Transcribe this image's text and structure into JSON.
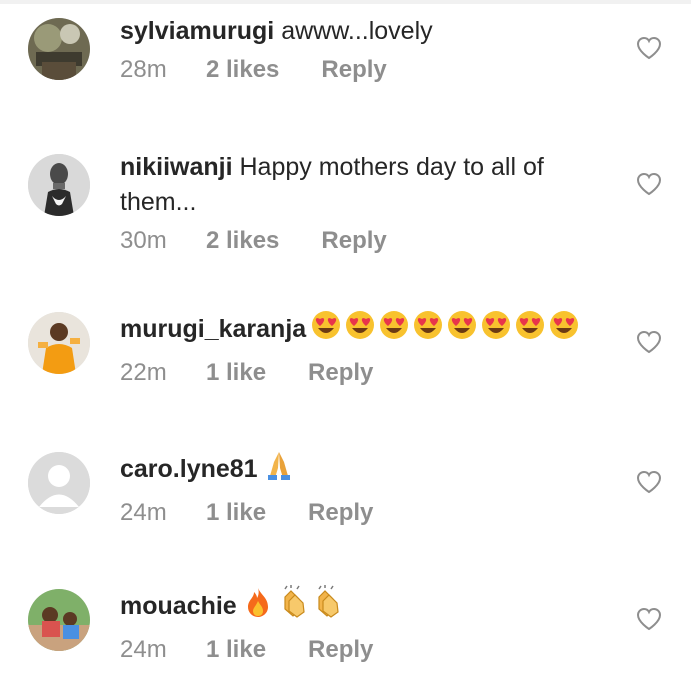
{
  "comments": [
    {
      "username": "sylviamurugi",
      "text": "awww...lovely",
      "emoji": "",
      "time": "28m",
      "likes": "2 likes",
      "reply": "Reply",
      "avatar": "photo-avatar"
    },
    {
      "username": "nikiiwanji",
      "text": "Happy mothers day to all of them...",
      "emoji": "",
      "time": "30m",
      "likes": "2 likes",
      "reply": "Reply",
      "avatar": "photo-avatar"
    },
    {
      "username": "murugi_karanja",
      "text": "",
      "emoji": "😍😍😍😍😍😍😍😍",
      "time": "22m",
      "likes": "1 like",
      "reply": "Reply",
      "avatar": "photo-avatar"
    },
    {
      "username": "caro.lyne81",
      "text": "",
      "emoji": "🙏",
      "time": "24m",
      "likes": "1 like",
      "reply": "Reply",
      "avatar": "default-avatar"
    },
    {
      "username": "mouachie",
      "text": "",
      "emoji": "🔥👏👏",
      "time": "24m",
      "likes": "1 like",
      "reply": "Reply",
      "avatar": "photo-avatar"
    }
  ],
  "icons": {
    "like": "heart-outline-icon"
  },
  "colors": {
    "text": "#262626",
    "meta": "#8e8e8e",
    "heart_stroke": "#8e8e8e"
  }
}
